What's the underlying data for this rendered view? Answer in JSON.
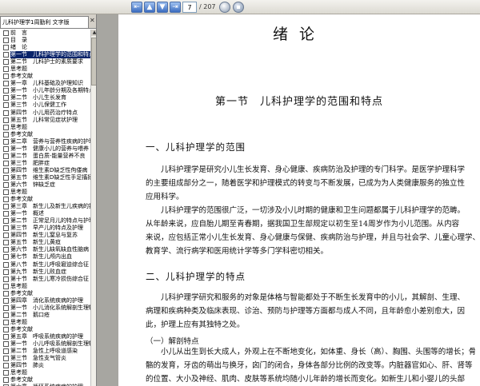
{
  "toolbar": {
    "page_current": "7",
    "page_total": "/ 207"
  },
  "sidebar": {
    "tab_label": "儿科护理学1周勤利 文字版",
    "outline": [
      "前　言",
      "目　录",
      "绪　论",
      "第一节　儿科护理学的范围和特点",
      "第二节　儿科护士的素质要求",
      "思考题",
      "参考文献",
      "第一章　儿科基础及护理知识",
      "第一节　小儿年龄分期及各期特点",
      "第二节　小儿生长发育",
      "第三节　小儿保健工作",
      "第四节　小儿用药治疗特点",
      "第五节　儿科常见症状护理",
      "思考题",
      "参考文献",
      "第二章　营养与营养性疾病的护理",
      "第一节　健康小儿的营养与喂养",
      "第二节　蛋白质-能量营养不良",
      "第三节　肥胖症",
      "第四节　维生素D缺乏性佝偻病",
      "第五节　维生素D缺乏性手足搐搦症",
      "第六节　锌缺乏症",
      "思考题",
      "参考文献",
      "第三章　新生儿及新生儿疾病的护理",
      "第一节　概述",
      "第二节　正常足月儿的特点与护理",
      "第三节　早产儿的特点及护理",
      "第四节　新生儿窒息与复苏",
      "第五节　新生儿黄疸",
      "第六节　新生儿缺氧缺血性脑病",
      "第七节　新生儿颅内出血",
      "第八节　新生儿呼吸窘迫综合征",
      "第九节　新生儿败血症",
      "第十节　新生儿寒冷损伤综合征",
      "思考题",
      "参考文献",
      "第四章　消化系统疾病的护理",
      "第一节　小儿消化系统解剖生理特点",
      "第二节　鹅口疮",
      "思考题",
      "参考文献",
      "第五章　呼吸系统疾病的护理",
      "第一节　小儿呼吸系统解剖生理特点",
      "第二节　急性上呼吸道感染",
      "第三节　急性支气管炎",
      "第四节　肺炎",
      "思考题",
      "参考文献",
      "第六章　循环系统疾病的护理"
    ]
  },
  "document": {
    "title": "绪论",
    "section_title": "第一节　儿科护理学的范围和特点",
    "h2_scope": "一、儿科护理学的范围",
    "para1": [
      "儿科护理学是研究小儿生长发育、身心健康、疾病防治及护理的专门科学。是医学护理科学",
      "的主要组成部分之一，随着医学和护理模式的转变与不断发展，已成为为人类健康服务的独立性",
      "应用科学。"
    ],
    "para2": [
      "儿科护理学的范围很广泛，一切涉及小儿时期的健康和卫生问题都属于儿科护理学的范畴。",
      "从年龄来说，应自胎儿期至青春期，据我国卫生部规定以初生至14周岁作为小儿范围。从内容",
      "来说，应包括正常小儿生长发育、身心健康与保健、疾病防治与护理，并且与社会学、儿童心理学、",
      "教育学、流行病学和医用统计学等多门学科密切相关。"
    ],
    "h2_features": "二、儿科护理学的特点",
    "para3": [
      "儿科护理学研究和服务的对象是体格与智能都处于不断生长发育中的小儿，其解剖、生理、",
      "病理和疾病种类及临床表现、诊治、预防与护理等方面都与成人不同，且年龄愈小差别愈大，因",
      "此，护理上应有其独特之处。"
    ],
    "h3_anatomy": "（一）解剖特点",
    "para4": [
      "小儿从出生到长大成人，外观上在不断地变化，如体重、身长（高）、胸围、头围等的增长；骨",
      "骼的发育，牙齿的萌出与换牙，囟门的闭合，身体各部分比例的改变等。内脏器官如心、肝、肾等",
      "的位置、大小及神经、肌肉、皮肤等系统均随小儿年龄的增长而变化。如新生儿和小婴儿的头部"
    ]
  }
}
